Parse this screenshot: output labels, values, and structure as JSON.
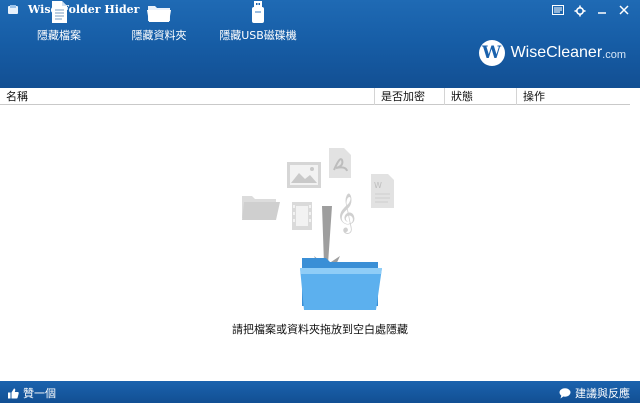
{
  "window": {
    "title": "Wise Folder Hider"
  },
  "toolbar": {
    "hide_file_label": "隱藏檔案",
    "hide_folder_label": "隱藏資料夾",
    "hide_usb_label": "隱藏USB磁碟機"
  },
  "brand": {
    "logo_letter": "W",
    "name": "WiseCleaner",
    "suffix": ".com"
  },
  "table": {
    "columns": [
      "名稱",
      "是否加密",
      "狀態",
      "操作"
    ]
  },
  "empty_state": {
    "hint": "請把檔案或資料夾拖放到空白處隱藏"
  },
  "footer": {
    "like_label": "贊一個",
    "feedback_label": "建議與反應"
  },
  "colors": {
    "header_blue": "#1a62ad",
    "footer_blue": "#124f93"
  }
}
